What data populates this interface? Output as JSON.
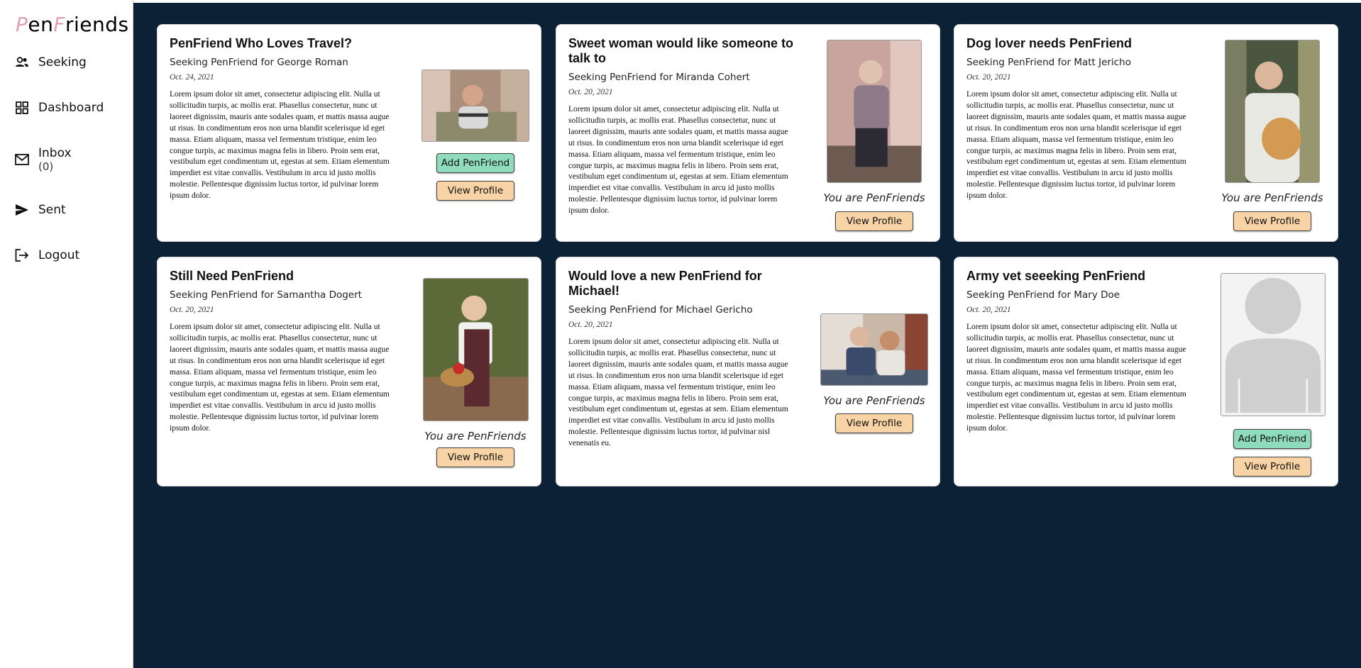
{
  "app": {
    "logo_p": "P",
    "logo_en": "en",
    "logo_f": "F",
    "logo_riends": "riends"
  },
  "nav": {
    "seeking": "Seeking",
    "dashboard": "Dashboard",
    "inbox": "Inbox",
    "inbox_count": "(0)",
    "sent": "Sent",
    "logout": "Logout"
  },
  "colors": {
    "main_bg": "#0c2135",
    "view_btn": "#f8d3a5",
    "add_btn": "#8fdbbd",
    "logo_accent": "#e0a0b4"
  },
  "cards": [
    {
      "title": "PenFriend Who Loves Travel?",
      "seeking": "Seeking PenFriend for George Roman",
      "date": "Oct. 24, 2021",
      "body": "Lorem ipsum dolor sit amet, consectetur adipiscing elit. Nulla ut sollicitudin turpis, ac mollis erat. Phasellus consectetur, nunc ut laoreet dignissim, mauris ante sodales quam, et mattis massa augue ut risus. In condimentum eros non urna blandit scelerisque id eget massa. Etiam aliquam, massa vel fermentum tristique, enim leo congue turpis, ac maximus magna felis in libero. Proin sem erat, vestibulum eget condimentum ut, egestas at sem. Etiam elementum imperdiet est vitae convallis. Vestibulum in arcu id justo mollis molestie. Pellentesque dignissim luctus tortor, id pulvinar lorem ipsum dolor.",
      "add_label": "Add PenFriend",
      "view_label": "View Profile"
    },
    {
      "title": "Sweet woman would like someone to talk to",
      "seeking": "Seeking PenFriend for Miranda Cohert",
      "date": "Oct. 20, 2021",
      "body": "Lorem ipsum dolor sit amet, consectetur adipiscing elit. Nulla ut sollicitudin turpis, ac mollis erat. Phasellus consectetur, nunc ut laoreet dignissim, mauris ante sodales quam, et mattis massa augue ut risus. In condimentum eros non urna blandit scelerisque id eget massa. Etiam aliquam, massa vel fermentum tristique, enim leo congue turpis, ac maximus magna felis in libero. Proin sem erat, vestibulum eget condimentum ut, egestas at sem. Etiam elementum imperdiet est vitae convallis. Vestibulum in arcu id justo mollis molestie. Pellentesque dignissim luctus tortor, id pulvinar lorem ipsum dolor.",
      "status": "You are PenFriends",
      "view_label": "View Profile"
    },
    {
      "title": "Dog lover needs PenFriend",
      "seeking": "Seeking PenFriend for Matt Jericho",
      "date": "Oct. 20, 2021",
      "body": "Lorem ipsum dolor sit amet, consectetur adipiscing elit. Nulla ut sollicitudin turpis, ac mollis erat. Phasellus consectetur, nunc ut laoreet dignissim, mauris ante sodales quam, et mattis massa augue ut risus. In condimentum eros non urna blandit scelerisque id eget massa. Etiam aliquam, massa vel fermentum tristique, enim leo congue turpis, ac maximus magna felis in libero. Proin sem erat, vestibulum eget condimentum ut, egestas at sem. Etiam elementum imperdiet est vitae convallis. Vestibulum in arcu id justo mollis molestie. Pellentesque dignissim luctus tortor, id pulvinar lorem ipsum dolor.",
      "status": "You are PenFriends",
      "view_label": "View Profile"
    },
    {
      "title": "Still Need PenFriend",
      "seeking": "Seeking PenFriend for Samantha Dogert",
      "date": "Oct. 20, 2021",
      "body": "Lorem ipsum dolor sit amet, consectetur adipiscing elit. Nulla ut sollicitudin turpis, ac mollis erat. Phasellus consectetur, nunc ut laoreet dignissim, mauris ante sodales quam, et mattis massa augue ut risus. In condimentum eros non urna blandit scelerisque id eget massa. Etiam aliquam, massa vel fermentum tristique, enim leo congue turpis, ac maximus magna felis in libero. Proin sem erat, vestibulum eget condimentum ut, egestas at sem. Etiam elementum imperdiet est vitae convallis. Vestibulum in arcu id justo mollis molestie. Pellentesque dignissim luctus tortor, id pulvinar lorem ipsum dolor.",
      "status": "You are PenFriends",
      "view_label": "View Profile"
    },
    {
      "title": "Would love a new PenFriend for Michael!",
      "seeking": "Seeking PenFriend for Michael Gericho",
      "date": "Oct. 20, 2021",
      "body": "Lorem ipsum dolor sit amet, consectetur adipiscing elit. Nulla ut sollicitudin turpis, ac mollis erat. Phasellus consectetur, nunc ut laoreet dignissim, mauris ante sodales quam, et mattis massa augue ut risus. In condimentum eros non urna blandit scelerisque id eget massa. Etiam aliquam, massa vel fermentum tristique, enim leo congue turpis, ac maximus magna felis in libero. Proin sem erat, vestibulum eget condimentum ut, egestas at sem. Etiam elementum imperdiet est vitae convallis. Vestibulum in arcu id justo mollis molestie. Pellentesque dignissim luctus tortor, id pulvinar nisl venenatis eu.",
      "status": "You are PenFriends",
      "view_label": "View Profile"
    },
    {
      "title": "Army vet seeeking PenFriend",
      "seeking": "Seeking PenFriend for Mary Doe",
      "date": "Oct. 20, 2021",
      "body": "Lorem ipsum dolor sit amet, consectetur adipiscing elit. Nulla ut sollicitudin turpis, ac mollis erat. Phasellus consectetur, nunc ut laoreet dignissim, mauris ante sodales quam, et mattis massa augue ut risus. In condimentum eros non urna blandit scelerisque id eget massa. Etiam aliquam, massa vel fermentum tristique, enim leo congue turpis, ac maximus magna felis in libero. Proin sem erat, vestibulum eget condimentum ut, egestas at sem. Etiam elementum imperdiet est vitae convallis. Vestibulum in arcu id justo mollis molestie. Pellentesque dignissim luctus tortor, id pulvinar lorem ipsum dolor.",
      "add_label": "Add PenFriend",
      "view_label": "View Profile"
    }
  ]
}
